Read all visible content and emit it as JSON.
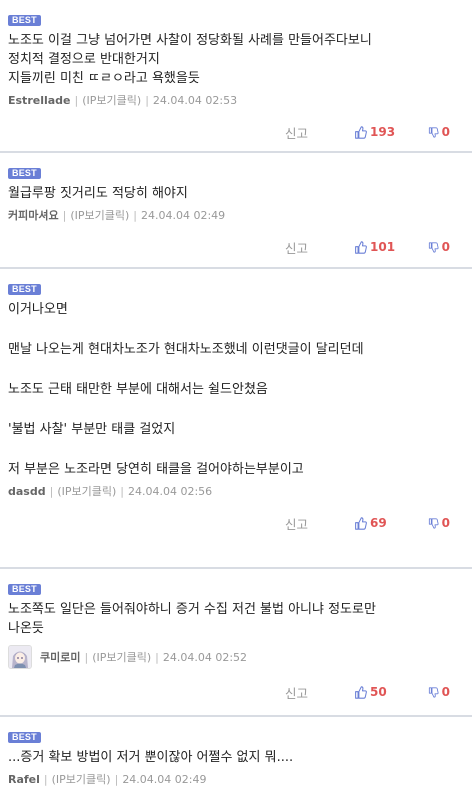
{
  "colors": {
    "badge": "#6a7fd6",
    "vote_icon": "#6a7fd6",
    "vote_count": "#e05555"
  },
  "comments": [
    {
      "badge": "BEST",
      "lines": [
        "노조도 이걸 그냥 넘어가면 사찰이 정당화될 사례를 만들어주다보니",
        "정치적 결정으로 반대한거지",
        "지들끼린 미친 ㄸㄹㅇ라고 욕했을듯"
      ],
      "nick": "Estrellade",
      "ip": "(IP보기클릭)",
      "time": "24.04.04 02:53",
      "report": "신고",
      "up": "193",
      "down": "0"
    },
    {
      "badge": "BEST",
      "lines": [
        "월급루팡 짓거리도 적당히 해야지"
      ],
      "nick": "커피마셔요",
      "ip": "(IP보기클릭)",
      "time": "24.04.04 02:49",
      "report": "신고",
      "up": "101",
      "down": "0"
    },
    {
      "badge": "BEST",
      "lines": [
        "이거나오면",
        "",
        "맨날 나오는게 현대차노조가 현대차노조했네 이런댓글이 달리던데",
        "",
        "노조도 근태 태만한 부분에 대해서는 쉴드안쳤음",
        "",
        "'불법 사찰' 부분만 태클 걸었지",
        "",
        "저 부분은 노조라면 당연히 태클을 걸어야하는부분이고"
      ],
      "nick": "dasdd",
      "ip": "(IP보기클릭)",
      "time": "24.04.04 02:56",
      "report": "신고",
      "up": "69",
      "down": "0"
    },
    {
      "badge": "BEST",
      "lines": [
        "노조쪽도 일단은 들어줘야하니 증거 수집 저건 불법 아니냐 정도로만",
        "나온듯"
      ],
      "nick": "쿠미로미",
      "ip": "(IP보기클릭)",
      "time": "24.04.04 02:52",
      "report": "신고",
      "up": "50",
      "down": "0",
      "avatar": "anime-avatar-icon"
    },
    {
      "badge": "BEST",
      "lines": [
        "...증거 확보 방법이 저거 뿐이잖아 어쩔수 없지 뭐...."
      ],
      "nick": "Rafel",
      "ip": "(IP보기클릭)",
      "time": "24.04.04 02:49"
    }
  ]
}
